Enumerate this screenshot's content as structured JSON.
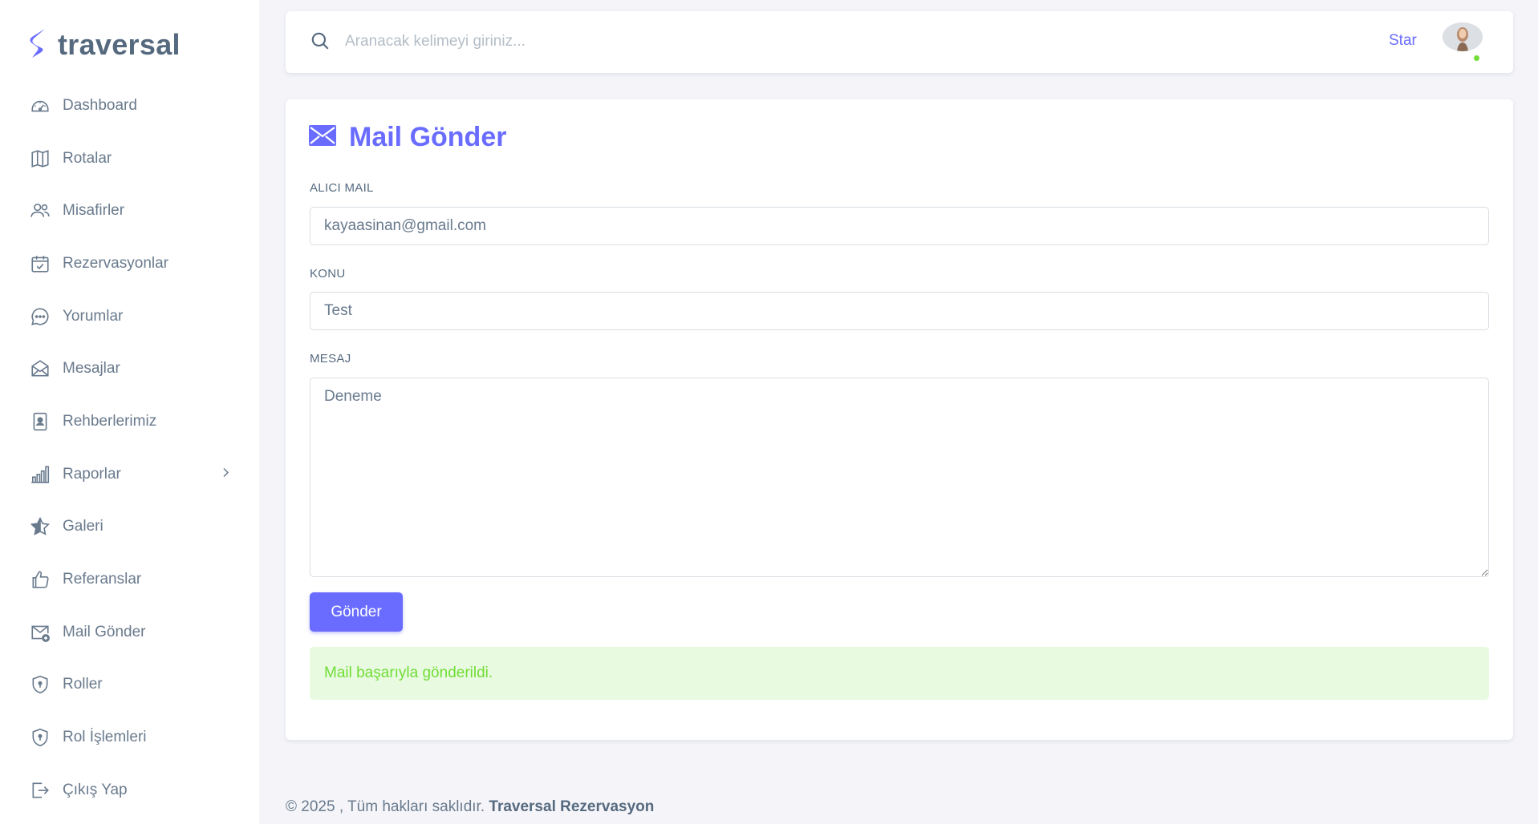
{
  "brand": {
    "name": "traversal",
    "color": "#696cff"
  },
  "sidebar": {
    "items": [
      {
        "label": "Dashboard",
        "icon": "dashboard-gauge-icon"
      },
      {
        "label": "Rotalar",
        "icon": "map-icon"
      },
      {
        "label": "Misafirler",
        "icon": "users-icon"
      },
      {
        "label": "Rezervasyonlar",
        "icon": "calendar-check-icon"
      },
      {
        "label": "Yorumlar",
        "icon": "chat-dots-icon"
      },
      {
        "label": "Mesajlar",
        "icon": "envelope-open-icon"
      },
      {
        "label": "Rehberlerimiz",
        "icon": "id-badge-icon"
      },
      {
        "label": "Raporlar",
        "icon": "bar-chart-icon",
        "has_submenu": true
      },
      {
        "label": "Galeri",
        "icon": "star-icon"
      },
      {
        "label": "Referanslar",
        "icon": "thumbs-up-icon"
      },
      {
        "label": "Mail Gönder",
        "icon": "mail-send-icon"
      },
      {
        "label": "Roller",
        "icon": "shield-icon"
      },
      {
        "label": "Rol İşlemleri",
        "icon": "shield-lock-icon"
      },
      {
        "label": "Çıkış Yap",
        "icon": "logout-icon"
      }
    ]
  },
  "topbar": {
    "search_placeholder": "Aranacak kelimeyi giriniz...",
    "star_label": "Star",
    "status_color": "#71dd37"
  },
  "form": {
    "title": "Mail Gönder",
    "recipient_label": "ALICI MAIL",
    "recipient_value": "kayaasinan@gmail.com",
    "subject_label": "KONU",
    "subject_value": "Test",
    "message_label": "MESAJ",
    "message_value": "Deneme",
    "submit_label": "Gönder",
    "success_message": "Mail başarıyla gönderildi."
  },
  "footer": {
    "copyright": "© 2025 , Tüm hakları saklıdır.",
    "company": "Traversal Rezervasyon"
  }
}
